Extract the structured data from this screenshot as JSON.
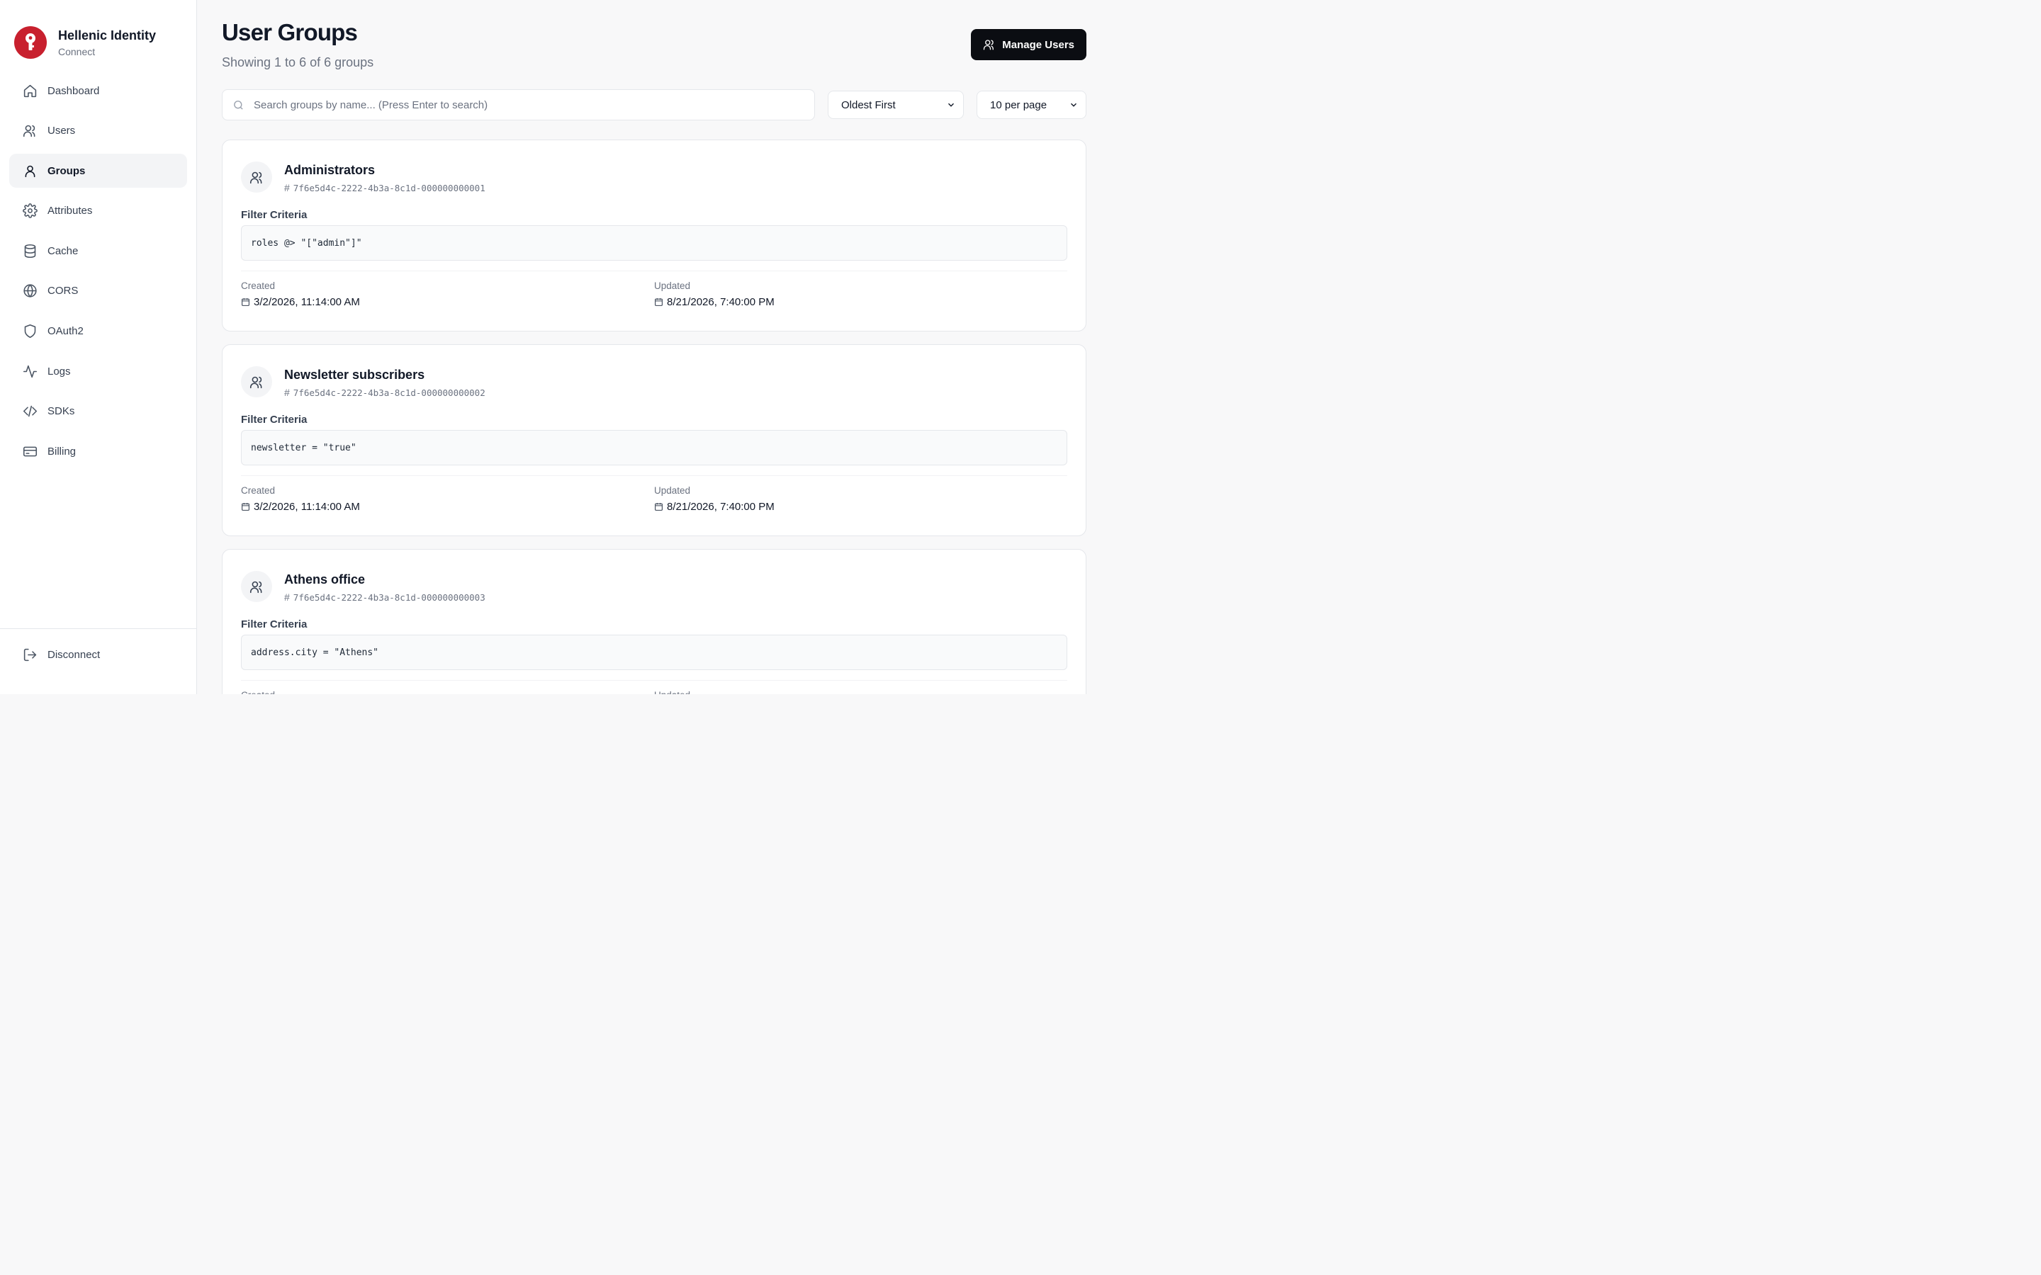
{
  "brand": {
    "name": "Hellenic Identity",
    "subtitle": "Connect",
    "accent": "#c8202e"
  },
  "sidebar": {
    "items": [
      {
        "label": "Dashboard",
        "icon": "home-icon"
      },
      {
        "label": "Users",
        "icon": "users-icon"
      },
      {
        "label": "Groups",
        "icon": "user-icon",
        "active": true
      },
      {
        "label": "Attributes",
        "icon": "gear-icon"
      },
      {
        "label": "Cache",
        "icon": "database-icon"
      },
      {
        "label": "CORS",
        "icon": "globe-icon"
      },
      {
        "label": "OAuth2",
        "icon": "shield-icon"
      },
      {
        "label": "Logs",
        "icon": "activity-icon"
      },
      {
        "label": "SDKs",
        "icon": "code-icon"
      },
      {
        "label": "Billing",
        "icon": "credit-card-icon"
      }
    ],
    "disconnect": "Disconnect"
  },
  "header": {
    "title": "User Groups",
    "subtitle": "Showing 1 to 6 of 6 groups",
    "manage_users": "Manage Users"
  },
  "toolbar": {
    "search_placeholder": "Search groups by name... (Press Enter to search)",
    "search_value": "",
    "sort": "Oldest First",
    "per_page": "10 per page"
  },
  "labels": {
    "filter_criteria": "Filter Criteria",
    "created": "Created",
    "updated": "Updated"
  },
  "groups": [
    {
      "name": "Administrators",
      "id": "7f6e5d4c-2222-4b3a-8c1d-000000000001",
      "criteria": "roles @> \"[\"admin\"]\"",
      "created": "3/2/2026, 11:14:00 AM",
      "updated": "8/21/2026, 7:40:00 PM"
    },
    {
      "name": "Newsletter subscribers",
      "id": "7f6e5d4c-2222-4b3a-8c1d-000000000002",
      "criteria": "newsletter = \"true\"",
      "created": "3/2/2026, 11:14:00 AM",
      "updated": "8/21/2026, 7:40:00 PM"
    },
    {
      "name": "Athens office",
      "id": "7f6e5d4c-2222-4b3a-8c1d-000000000003",
      "criteria": "address.city = \"Athens\"",
      "created": "",
      "updated": ""
    }
  ]
}
